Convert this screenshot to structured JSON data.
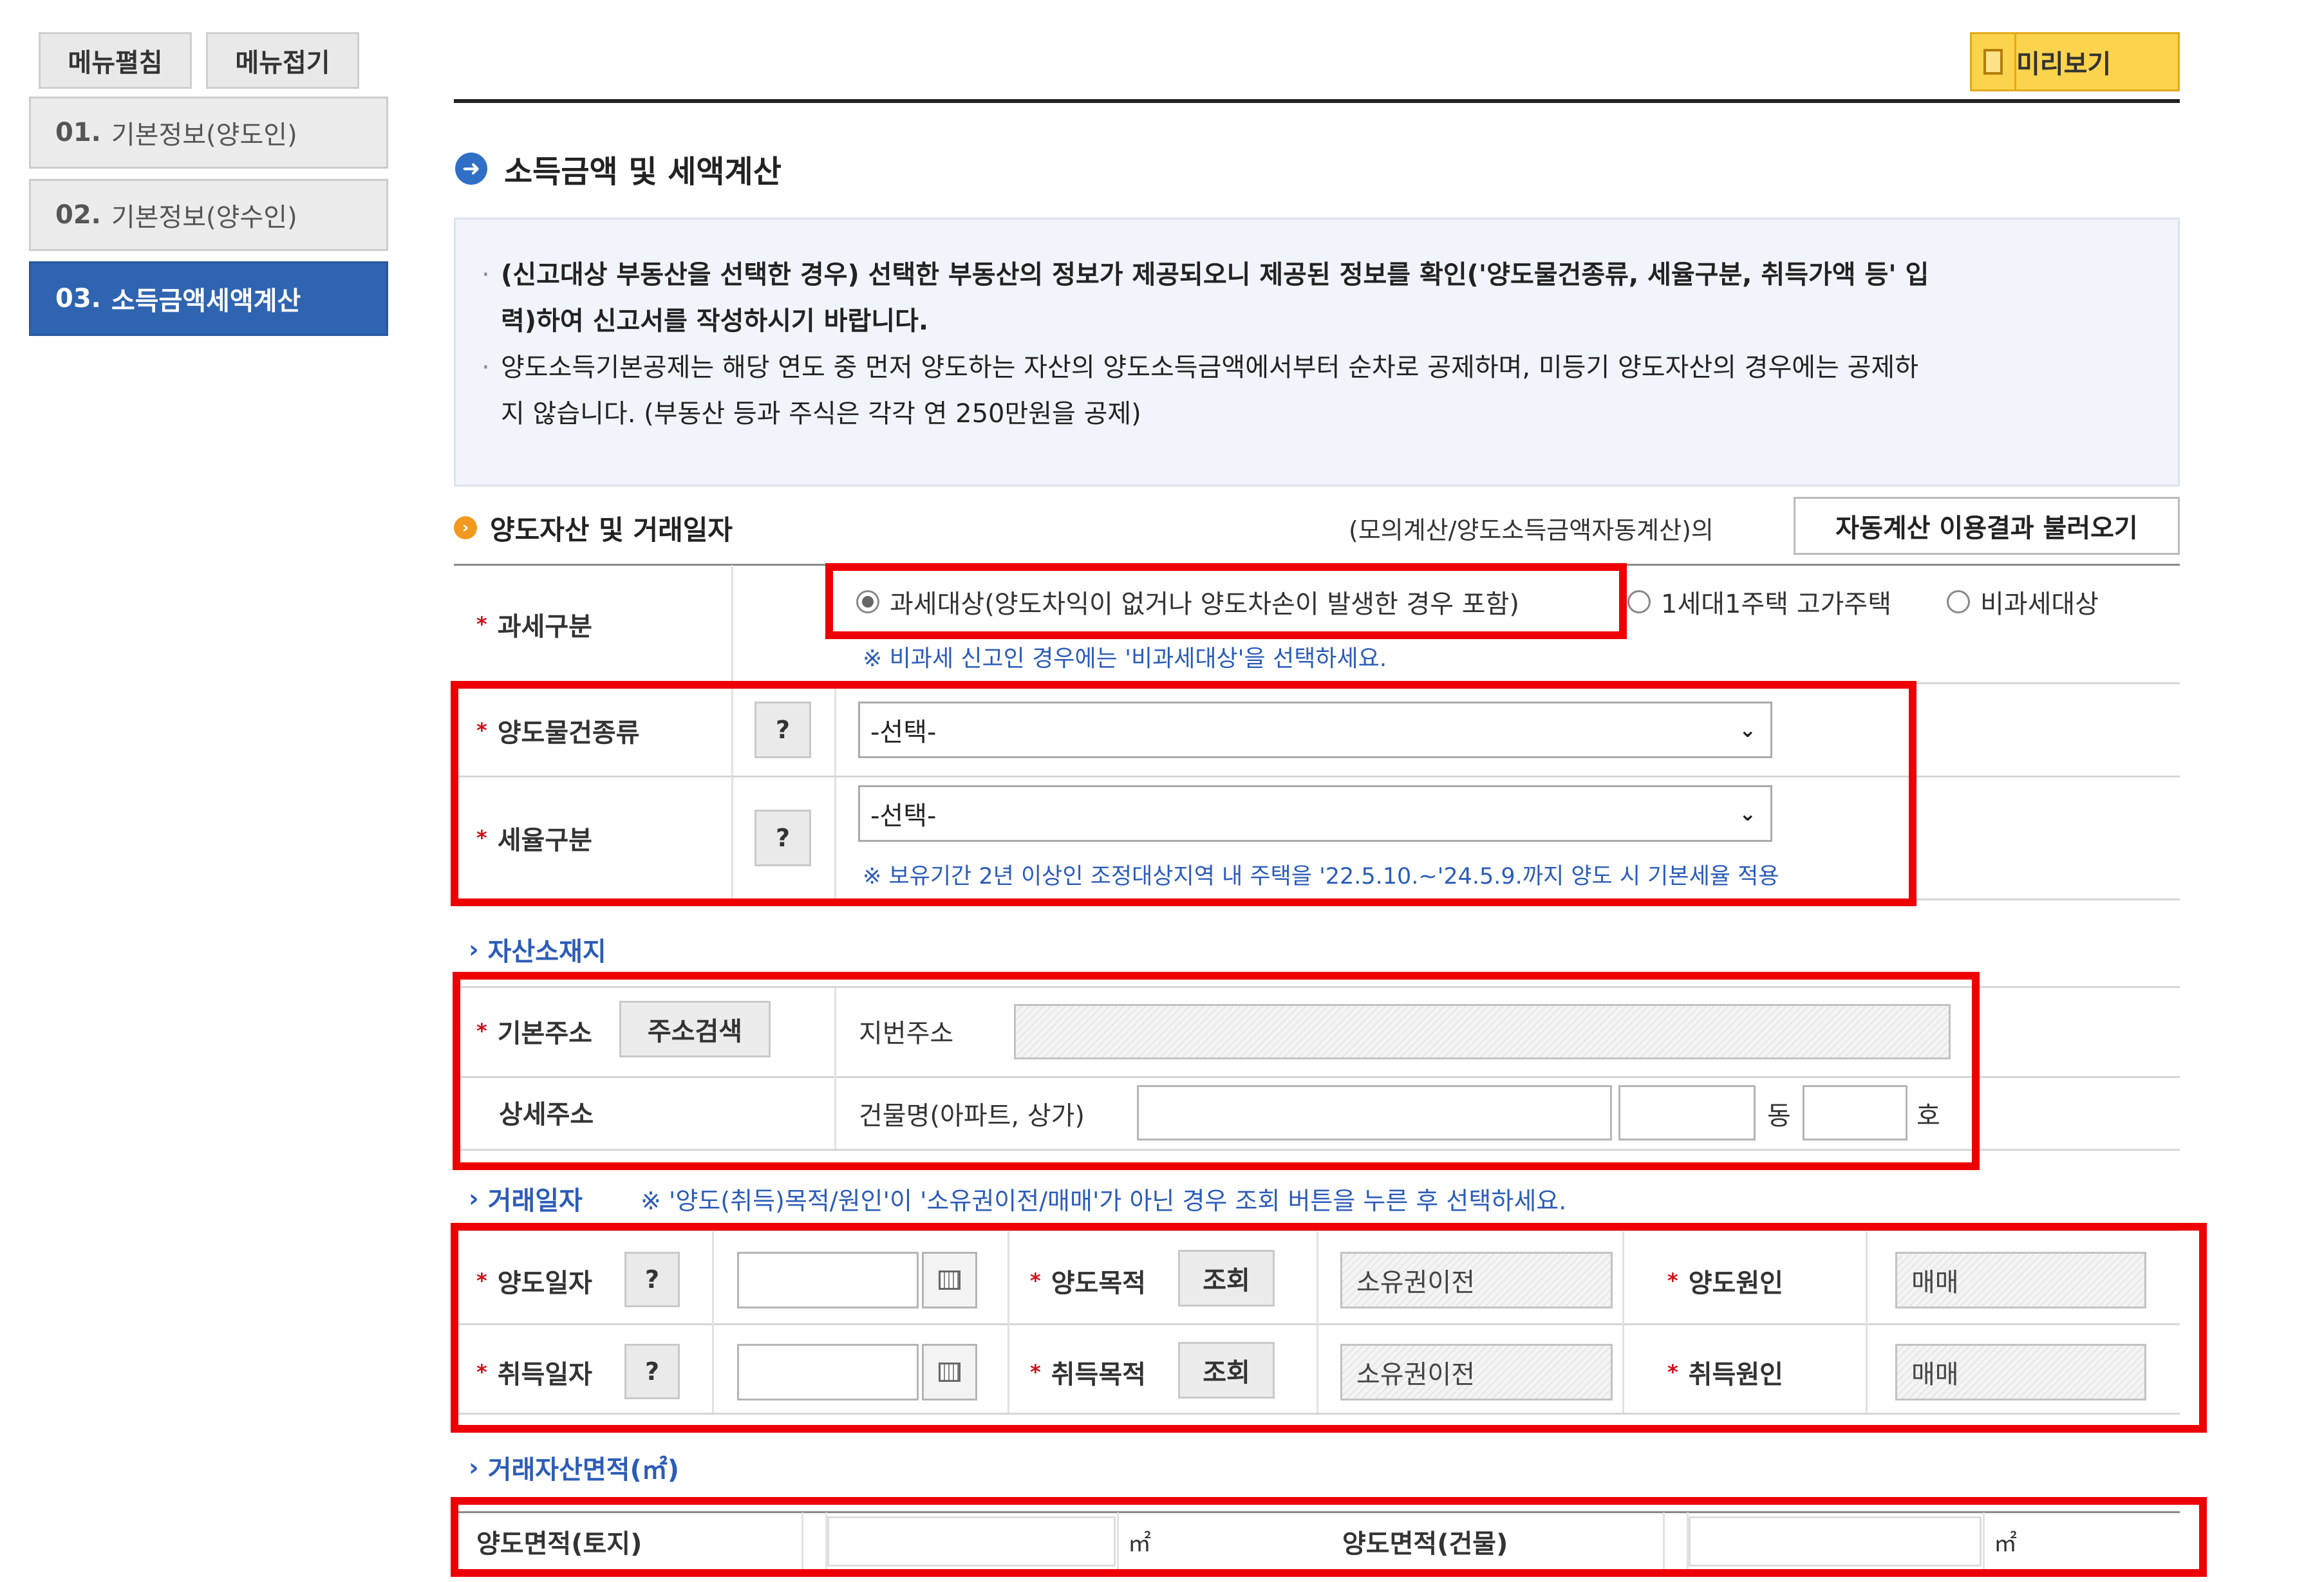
{
  "sidebar": {
    "menu_expand": "메뉴펼침",
    "menu_collapse": "메뉴접기",
    "items": [
      {
        "num": "01.",
        "label": "기본정보(양도인)"
      },
      {
        "num": "02.",
        "label": "기본정보(양수인)"
      },
      {
        "num": "03.",
        "label": "소득금액세액계산"
      }
    ]
  },
  "header": {
    "preview_label": "미리보기"
  },
  "section": {
    "title": "소득금액 및 세액계산"
  },
  "notice": {
    "line1": "(신고대상 부동산을 선택한 경우) 선택한 부동산의 정보가 제공되오니 제공된 정보를 확인('양도물건종류, 세율구분, 취득가액 등' 입",
    "line1b": "력)하여 신고서를 작성하시기 바랍니다.",
    "line2": "양도소득기본공제는 해당 연도 중 먼저 양도하는 자산의 양도소득금액에서부터 순차로 공제하며, 미등기 양도자산의 경우에는 공제하",
    "line2b": "지 않습니다. (부동산 등과 주식은 각각 연 250만원을 공제)"
  },
  "asset": {
    "title": "양도자산 및 거래일자",
    "mock_text": "(모의계산/양도소득금액자동계산)의",
    "load_button": "자동계산 이용결과 불러오기",
    "tax_class_label": "과세구분",
    "radio_options": [
      "과세대상(양도차익이 없거나 양도차손이 발생한 경우 포함)",
      "1세대1주택 고가주택",
      "비과세대상"
    ],
    "tax_hint": "※ 비과세 신고인 경우에는 '비과세대상'을 선택하세요.",
    "item_type_label": "양도물건종류",
    "item_type_value": "-선택-",
    "rate_label": "세율구분",
    "rate_value": "-선택-",
    "rate_hint": "※ 보유기간 2년 이상인 조정대상지역 내 주택을 '22.5.10.~'24.5.9.까지 양도 시 기본세율 적용",
    "q": "?"
  },
  "location": {
    "title": "자산소재지",
    "basic_label": "기본주소",
    "search_button": "주소검색",
    "jibun_label": "지번주소",
    "detail_label": "상세주소",
    "building_label": "건물명(아파트, 상가)",
    "dong": "동",
    "ho": "호"
  },
  "trade": {
    "title": "거래일자",
    "hint": "※ '양도(취득)목적/원인'이 '소유권이전/매매'가 아닌 경우 조회 버튼을 누른 후 선택하세요.",
    "sell_date_label": "양도일자",
    "buy_date_label": "취득일자",
    "sell_purpose_label": "양도목적",
    "buy_purpose_label": "취득목적",
    "lookup": "조회",
    "sell_purpose_value": "소유권이전",
    "buy_purpose_value": "소유권이전",
    "sell_cause_label": "양도원인",
    "buy_cause_label": "취득원인",
    "sell_cause_value": "매매",
    "buy_cause_value": "매매"
  },
  "area": {
    "title": "거래자산면적(㎡)",
    "land_label": "양도면적(토지)",
    "building_label": "양도면적(건물)",
    "unit": "㎡"
  }
}
